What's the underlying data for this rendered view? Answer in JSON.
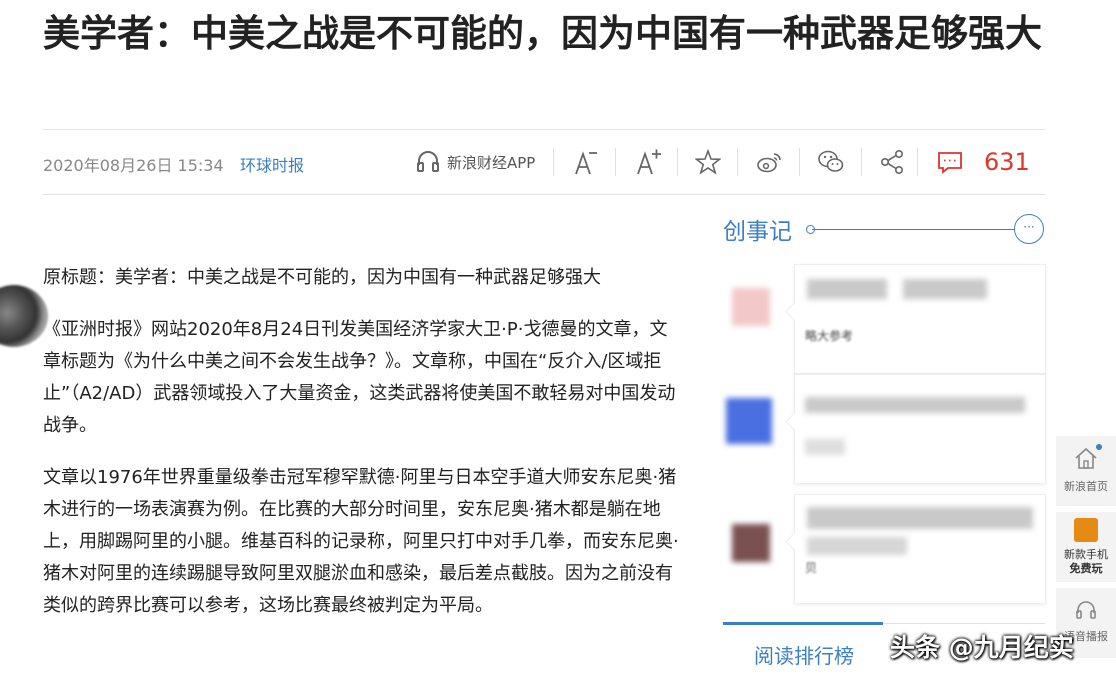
{
  "article": {
    "title": "美学者：中美之战是不可能的，因为中国有一种武器足够强大",
    "date": "2020年08月26日 15:34",
    "source": "环球时报",
    "paragraphs": [
      "原标题：美学者：中美之战是不可能的，因为中国有一种武器足够强大",
      "《亚洲时报》网站2020年8月24日刊发美国经济学家大卫·P·戈德曼的文章，文章标题为《为什么中美之间不会发生战争？》。文章称，中国在“反介入/区域拒止”（A2/AD）武器领域投入了大量资金，这类武器将使美国不敢轻易对中国发动战争。",
      "文章以1976年世界重量级拳击冠军穆罕默德·阿里与日本空手道大师安东尼奥·猪木进行的一场表演赛为例。在比赛的大部分时间里，安东尼奥·猪木都是躺在地上，用脚踢阿里的小腿。维基百科的记录称，阿里只打中对手几拳，而安东尼奥·猪木对阿里的连续踢腿导致阿里双腿淤血和感染，最后差点截肢。因为之前没有类似的跨界比赛可以参考，这场比赛最终被判定为平局。"
    ]
  },
  "toolbar": {
    "app_label": "新浪财经APP",
    "comment_count": "631",
    "icons": [
      "headphones-icon",
      "font-decrease-icon",
      "font-increase-icon",
      "star-icon",
      "weibo-icon",
      "wechat-icon",
      "share-icon",
      "comment-icon"
    ]
  },
  "sidebar": {
    "title": "创事记",
    "more_label": "···",
    "feed_snippets": [
      "略大参考",
      "贝"
    ],
    "rank_tab": "阅读排行榜"
  },
  "float_nav": {
    "home_label": "新浪首页",
    "phone_label": "新款手机",
    "phone_sub": "免费玩",
    "listen_label": "语音播报"
  },
  "watermark": "头条 @九月纪实",
  "colors": {
    "accent": "#3b7fc4",
    "comment": "#e0342b"
  }
}
